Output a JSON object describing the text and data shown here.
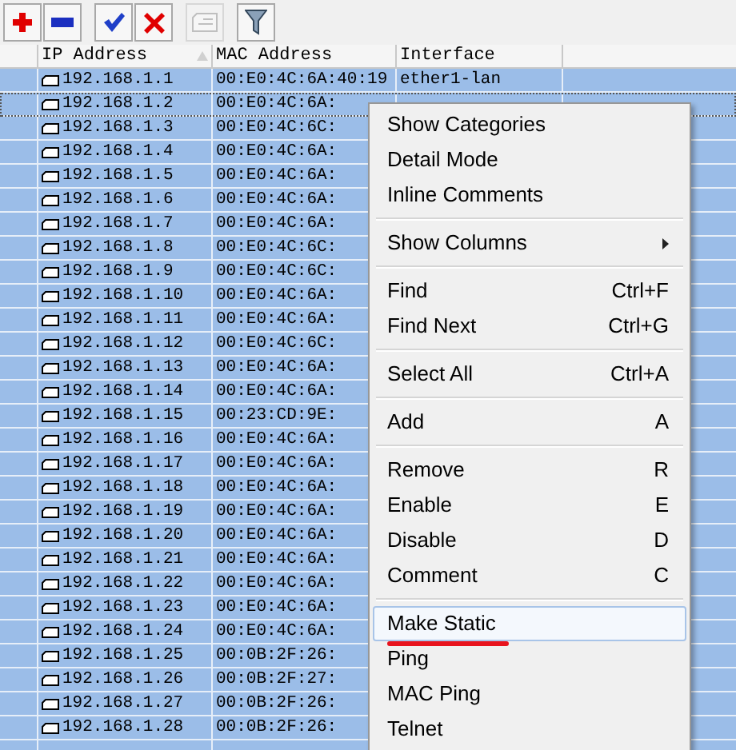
{
  "toolbar": {
    "buttons": [
      {
        "kind": "add",
        "disabled": false
      },
      {
        "kind": "remove",
        "disabled": false
      },
      {
        "kind": "enable",
        "disabled": false
      },
      {
        "kind": "disable",
        "disabled": false
      },
      {
        "kind": "comment",
        "disabled": true
      },
      {
        "kind": "filter",
        "disabled": false
      }
    ]
  },
  "table": {
    "columns": [
      {
        "label": "IP Address",
        "sorted": true
      },
      {
        "label": "MAC Address",
        "sorted": false
      },
      {
        "label": "Interface",
        "sorted": false
      }
    ],
    "rows": [
      {
        "ip": "192.168.1.1",
        "mac": "00:E0:4C:6A:40:19",
        "interface": "ether1-lan",
        "selected": true,
        "focused": false
      },
      {
        "ip": "192.168.1.2",
        "mac": "00:E0:4C:6A:",
        "selected": true,
        "focused": true
      },
      {
        "ip": "192.168.1.3",
        "mac": "00:E0:4C:6C:",
        "selected": true,
        "focused": false
      },
      {
        "ip": "192.168.1.4",
        "mac": "00:E0:4C:6A:",
        "selected": true,
        "focused": false
      },
      {
        "ip": "192.168.1.5",
        "mac": "00:E0:4C:6A:",
        "selected": true,
        "focused": false
      },
      {
        "ip": "192.168.1.6",
        "mac": "00:E0:4C:6A:",
        "selected": true,
        "focused": false
      },
      {
        "ip": "192.168.1.7",
        "mac": "00:E0:4C:6A:",
        "selected": true,
        "focused": false
      },
      {
        "ip": "192.168.1.8",
        "mac": "00:E0:4C:6C:",
        "selected": true,
        "focused": false
      },
      {
        "ip": "192.168.1.9",
        "mac": "00:E0:4C:6C:",
        "selected": true,
        "focused": false
      },
      {
        "ip": "192.168.1.10",
        "mac": "00:E0:4C:6A:",
        "selected": true,
        "focused": false
      },
      {
        "ip": "192.168.1.11",
        "mac": "00:E0:4C:6A:",
        "selected": true,
        "focused": false
      },
      {
        "ip": "192.168.1.12",
        "mac": "00:E0:4C:6C:",
        "selected": true,
        "focused": false
      },
      {
        "ip": "192.168.1.13",
        "mac": "00:E0:4C:6A:",
        "selected": true,
        "focused": false
      },
      {
        "ip": "192.168.1.14",
        "mac": "00:E0:4C:6A:",
        "selected": true,
        "focused": false
      },
      {
        "ip": "192.168.1.15",
        "mac": "00:23:CD:9E:",
        "selected": true,
        "focused": false
      },
      {
        "ip": "192.168.1.16",
        "mac": "00:E0:4C:6A:",
        "selected": true,
        "focused": false
      },
      {
        "ip": "192.168.1.17",
        "mac": "00:E0:4C:6A:",
        "selected": true,
        "focused": false
      },
      {
        "ip": "192.168.1.18",
        "mac": "00:E0:4C:6A:",
        "selected": true,
        "focused": false
      },
      {
        "ip": "192.168.1.19",
        "mac": "00:E0:4C:6A:",
        "selected": true,
        "focused": false
      },
      {
        "ip": "192.168.1.20",
        "mac": "00:E0:4C:6A:",
        "selected": true,
        "focused": false
      },
      {
        "ip": "192.168.1.21",
        "mac": "00:E0:4C:6A:",
        "selected": true,
        "focused": false
      },
      {
        "ip": "192.168.1.22",
        "mac": "00:E0:4C:6A:",
        "selected": true,
        "focused": false
      },
      {
        "ip": "192.168.1.23",
        "mac": "00:E0:4C:6A:",
        "selected": true,
        "focused": false
      },
      {
        "ip": "192.168.1.24",
        "mac": "00:E0:4C:6A:",
        "selected": true,
        "focused": false
      },
      {
        "ip": "192.168.1.25",
        "mac": "00:0B:2F:26:",
        "selected": true,
        "focused": false
      },
      {
        "ip": "192.168.1.26",
        "mac": "00:0B:2F:27:",
        "selected": true,
        "focused": false
      },
      {
        "ip": "192.168.1.27",
        "mac": "00:0B:2F:26:",
        "selected": true,
        "focused": false
      },
      {
        "ip": "192.168.1.28",
        "mac": "00:0B:2F:26:",
        "selected": true,
        "focused": false
      }
    ]
  },
  "context_menu": {
    "groups": [
      [
        {
          "label": "Show Categories",
          "selected": false
        },
        {
          "label": "Detail Mode",
          "selected": false
        },
        {
          "label": "Inline Comments",
          "selected": false
        }
      ],
      [
        {
          "label": "Show Columns",
          "submenu": true,
          "selected": false
        }
      ],
      [
        {
          "label": "Find",
          "shortcut": "Ctrl+F",
          "selected": false
        },
        {
          "label": "Find Next",
          "shortcut": "Ctrl+G",
          "selected": false
        }
      ],
      [
        {
          "label": "Select All",
          "shortcut": "Ctrl+A",
          "selected": false
        }
      ],
      [
        {
          "label": "Add",
          "shortcut": "A",
          "selected": false
        }
      ],
      [
        {
          "label": "Remove",
          "shortcut": "R",
          "selected": false
        },
        {
          "label": "Enable",
          "shortcut": "E",
          "selected": false
        },
        {
          "label": "Disable",
          "shortcut": "D",
          "selected": false
        },
        {
          "label": "Comment",
          "shortcut": "C",
          "selected": false
        }
      ],
      [
        {
          "label": "Make Static",
          "selected": true,
          "underlined": true
        },
        {
          "label": "Ping",
          "selected": false
        },
        {
          "label": "MAC Ping",
          "selected": false
        },
        {
          "label": "Telnet",
          "selected": false
        }
      ]
    ]
  }
}
